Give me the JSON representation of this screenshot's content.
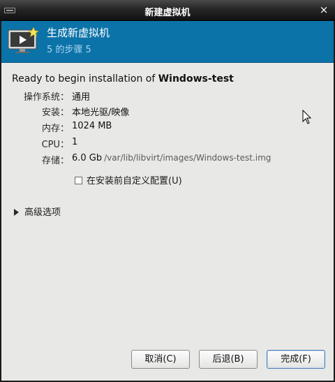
{
  "window": {
    "title": "新建虚拟机",
    "close_label": "×"
  },
  "banner": {
    "title": "生成新虚拟机",
    "step": "5 的步骤 5"
  },
  "summary": {
    "ready_prefix": "Ready to begin installation of ",
    "vm_name": "Windows-test",
    "rows": [
      {
        "label": "操作系统：",
        "value": "通用"
      },
      {
        "label": "安装：",
        "value": "本地光驱/映像"
      },
      {
        "label": "内存：",
        "value": "1024 MB"
      },
      {
        "label": "CPU：",
        "value": "1"
      },
      {
        "label": "存储：",
        "value": "6.0 Gb",
        "path": "/var/lib/libvirt/images/Windows-test.img"
      }
    ],
    "customize_checkbox": {
      "label": "在安装前自定义配置(U)",
      "checked": false
    }
  },
  "advanced": {
    "label": "高级选项",
    "expanded": false
  },
  "buttons": {
    "cancel": "取消(C)",
    "back": "后退(B)",
    "finish": "完成(F)"
  },
  "colors": {
    "banner": "#0c73a8",
    "banner_subtitle": "#a9d4ee",
    "client_bg": "#e8e8e6"
  }
}
